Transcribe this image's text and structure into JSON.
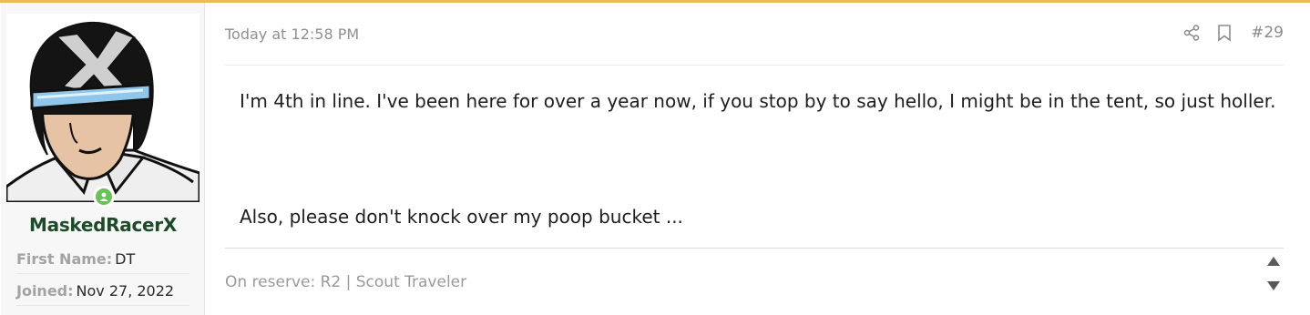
{
  "colors": {
    "accent_border": "#e9b95a",
    "username": "#1d4b2a",
    "online": "#6ac259"
  },
  "user": {
    "username": "MaskedRacerX",
    "avatar_icon": "masked-racer-avatar",
    "status_icon": "online-status-icon",
    "fields": [
      {
        "label": "First Name:",
        "value": "DT"
      },
      {
        "label": "Joined:",
        "value": "Nov 27, 2022"
      }
    ]
  },
  "post": {
    "date": "Today at 12:58 PM",
    "number": "#29",
    "icons": {
      "share": "share-icon",
      "bookmark": "bookmark-icon"
    },
    "paragraphs": [
      "I'm 4th in line. I've been here for over a year now, if you stop by to say hello, I might be in the tent, so just holler.",
      "Also, please don't knock over my poop bucket ..."
    ],
    "signature": "On reserve: R2 | Scout Traveler",
    "vote_icons": {
      "up": "upvote-arrow-icon",
      "down": "downvote-arrow-icon"
    }
  }
}
